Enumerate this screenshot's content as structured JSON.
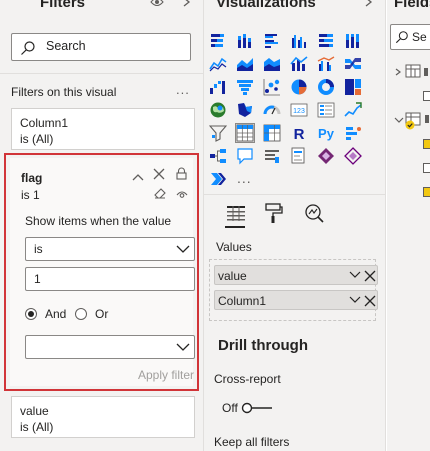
{
  "filters_pane": {
    "title": "Filters",
    "search_placeholder": "Search",
    "section_label": "Filters on this visual",
    "more_label": "...",
    "cards": [
      {
        "name": "Column1",
        "summary": "is (All)"
      },
      {
        "name": "value",
        "summary": "is (All)"
      }
    ],
    "flag_filter": {
      "name": "flag",
      "summary": "is 1",
      "show_items_label": "Show items when the value",
      "operator_value": "is",
      "value": "1",
      "logic_and": "And",
      "logic_or": "Or",
      "second_operator_value": "",
      "apply_label": "Apply filter",
      "highlight_color": "#d13438"
    }
  },
  "visualizations_pane": {
    "title": "Visualizations",
    "more_visuals": "...",
    "values_label": "Values",
    "fields": [
      {
        "label": "value"
      },
      {
        "label": "Column1"
      }
    ],
    "drill_through_title": "Drill through",
    "cross_report_label": "Cross-report",
    "cross_report_state": "Off",
    "keep_all_filters_label": "Keep all filters"
  },
  "fields_pane": {
    "title": "Fields",
    "search_placeholder": "Se"
  },
  "colors": {
    "accent_yellow": "#f2c811",
    "viz_blue": "#118dff",
    "viz_dark_blue": "#12239e",
    "viz_orange": "#e66c37",
    "viz_purple": "#6b007b"
  }
}
